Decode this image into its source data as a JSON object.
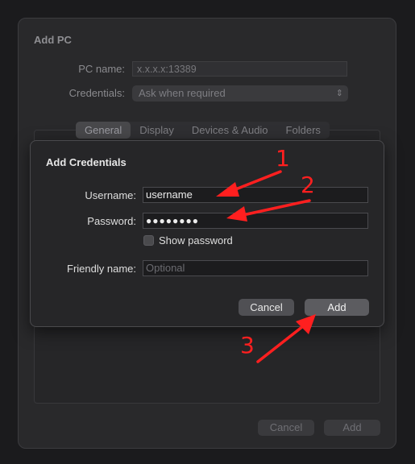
{
  "outer": {
    "title": "Add PC",
    "pc_name_label": "PC name:",
    "pc_name_value": "x.x.x.x:13389",
    "credentials_label": "Credentials:",
    "credentials_value": "Ask when required",
    "tabs": [
      {
        "label": "General",
        "active": true
      },
      {
        "label": "Display",
        "active": false
      },
      {
        "label": "Devices & Audio",
        "active": false
      },
      {
        "label": "Folders",
        "active": false
      }
    ],
    "cancel_label": "Cancel",
    "add_label": "Add"
  },
  "sheet": {
    "title": "Add Credentials",
    "username_label": "Username:",
    "username_value": "username",
    "password_label": "Password:",
    "password_value": "●●●●●●●●",
    "show_password_label": "Show password",
    "show_password_checked": false,
    "friendly_name_label": "Friendly name:",
    "friendly_name_placeholder": "Optional",
    "cancel_label": "Cancel",
    "add_label": "Add"
  },
  "annotations": {
    "color": "#ff1f1f",
    "labels": [
      "1",
      "2",
      "3"
    ]
  }
}
